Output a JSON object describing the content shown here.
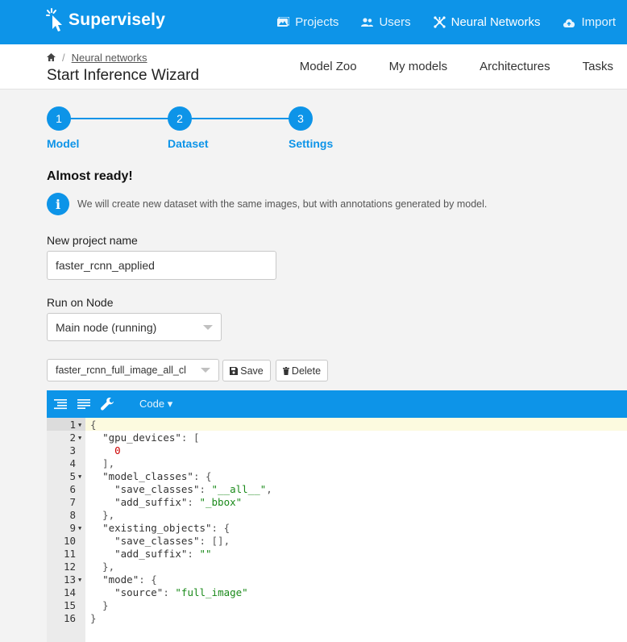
{
  "app": {
    "name": "Supervisely"
  },
  "topnav": [
    {
      "label": "Projects",
      "icon": "projects-icon",
      "active": false
    },
    {
      "label": "Users",
      "icon": "users-icon",
      "active": false
    },
    {
      "label": "Neural Networks",
      "icon": "neural-network-icon",
      "active": true
    },
    {
      "label": "Import",
      "icon": "cloud-upload-icon",
      "active": false
    }
  ],
  "breadcrumb": {
    "home_icon": "home-icon",
    "link": "Neural networks"
  },
  "page_title": "Start Inference Wizard",
  "subnav": [
    "Model Zoo",
    "My models",
    "Architectures",
    "Tasks"
  ],
  "steps": [
    {
      "number": "1",
      "label": "Model"
    },
    {
      "number": "2",
      "label": "Dataset"
    },
    {
      "number": "3",
      "label": "Settings"
    }
  ],
  "heading": "Almost ready!",
  "info": {
    "icon": "info-icon",
    "text": "We will create new dataset with the same images, but with annotations generated by model."
  },
  "project_name": {
    "label": "New project name",
    "value": "faster_rcnn_applied"
  },
  "node": {
    "label": "Run on Node",
    "selected": "Main node (running)"
  },
  "preset": {
    "selected": "faster_rcnn_full_image_all_cl",
    "save_label": "Save",
    "delete_label": "Delete"
  },
  "editor": {
    "toolbar_icons": [
      "format-icon",
      "compact-icon",
      "wrench-icon"
    ],
    "mode_label": "Code ▾",
    "lines": [
      {
        "n": "1",
        "fold": true
      },
      {
        "n": "2",
        "fold": true
      },
      {
        "n": "3",
        "fold": false
      },
      {
        "n": "4",
        "fold": false
      },
      {
        "n": "5",
        "fold": true
      },
      {
        "n": "6",
        "fold": false
      },
      {
        "n": "7",
        "fold": false
      },
      {
        "n": "8",
        "fold": false
      },
      {
        "n": "9",
        "fold": true
      },
      {
        "n": "10",
        "fold": false
      },
      {
        "n": "11",
        "fold": false
      },
      {
        "n": "12",
        "fold": false
      },
      {
        "n": "13",
        "fold": true
      },
      {
        "n": "14",
        "fold": false
      },
      {
        "n": "15",
        "fold": false
      },
      {
        "n": "16",
        "fold": false
      }
    ],
    "code": [
      [
        [
          "p",
          "{"
        ]
      ],
      [
        [
          "p",
          "  "
        ],
        [
          "k",
          "\"gpu_devices\""
        ],
        [
          "p",
          ": ["
        ]
      ],
      [
        [
          "p",
          "    "
        ],
        [
          "n",
          "0"
        ]
      ],
      [
        [
          "p",
          "  ],"
        ]
      ],
      [
        [
          "p",
          "  "
        ],
        [
          "k",
          "\"model_classes\""
        ],
        [
          "p",
          ": {"
        ]
      ],
      [
        [
          "p",
          "    "
        ],
        [
          "k",
          "\"save_classes\""
        ],
        [
          "p",
          ": "
        ],
        [
          "s",
          "\"__all__\""
        ],
        [
          "p",
          ","
        ]
      ],
      [
        [
          "p",
          "    "
        ],
        [
          "k",
          "\"add_suffix\""
        ],
        [
          "p",
          ": "
        ],
        [
          "s",
          "\"_bbox\""
        ]
      ],
      [
        [
          "p",
          "  },"
        ]
      ],
      [
        [
          "p",
          "  "
        ],
        [
          "k",
          "\"existing_objects\""
        ],
        [
          "p",
          ": {"
        ]
      ],
      [
        [
          "p",
          "    "
        ],
        [
          "k",
          "\"save_classes\""
        ],
        [
          "p",
          ": [],"
        ]
      ],
      [
        [
          "p",
          "    "
        ],
        [
          "k",
          "\"add_suffix\""
        ],
        [
          "p",
          ": "
        ],
        [
          "s",
          "\"\""
        ]
      ],
      [
        [
          "p",
          "  },"
        ]
      ],
      [
        [
          "p",
          "  "
        ],
        [
          "k",
          "\"mode\""
        ],
        [
          "p",
          ": {"
        ]
      ],
      [
        [
          "p",
          "    "
        ],
        [
          "k",
          "\"source\""
        ],
        [
          "p",
          ": "
        ],
        [
          "s",
          "\"full_image\""
        ]
      ],
      [
        [
          "p",
          "  }"
        ]
      ],
      [
        [
          "p",
          "}"
        ]
      ]
    ]
  },
  "colors": {
    "primary": "#0d94e8",
    "string": "#1a8a1a",
    "number": "#cc0000"
  }
}
